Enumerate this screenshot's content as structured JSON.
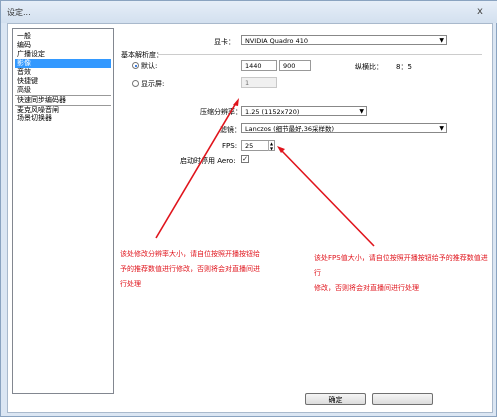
{
  "window": {
    "title": "设定...",
    "close_glyph": "x"
  },
  "sidebar": {
    "items": [
      {
        "label": "一般"
      },
      {
        "label": "编码"
      },
      {
        "label": "广播设定"
      },
      {
        "label": "影像"
      },
      {
        "label": "音效"
      },
      {
        "label": "快捷键"
      },
      {
        "label": "高级"
      },
      {
        "label": "快速同步编码器"
      },
      {
        "label": "麦克风噪音闸"
      },
      {
        "label": "场景切换器"
      }
    ],
    "selected_index": 3
  },
  "video": {
    "gpu_label": "显卡：",
    "gpu_value": "NVIDIA Quadro 410",
    "base_res_label": "基本解析度：",
    "default_label": "默认:",
    "width": "1440",
    "height": "900",
    "aspect_label": "纵横比：",
    "aspect_value": "8：5",
    "monitor_label": "显示屏:",
    "monitor_value": "1",
    "downscale_label": "压缩分辨率：",
    "downscale_value": "1.25  (1152x720)",
    "filter_label": "滤镜：",
    "filter_value": "Lanczos (细节最好,36采样数)",
    "fps_label": "FPS:",
    "fps_value": "25",
    "aero_label": "启动时停用 Aero:",
    "aero_checked": true
  },
  "annotations": {
    "left_note": [
      "该处修改分辨率大小，请自位按照开播按钮给",
      "予的推荐数值进行修改，否则将会对直播间进",
      "行处理"
    ],
    "right_note": [
      "该处FPS值大小，请自位按照开播按钮给予的推荐数值进行",
      "修改，否则将会对直播间进行处理"
    ]
  },
  "footer": {
    "ok_label": "确定"
  }
}
